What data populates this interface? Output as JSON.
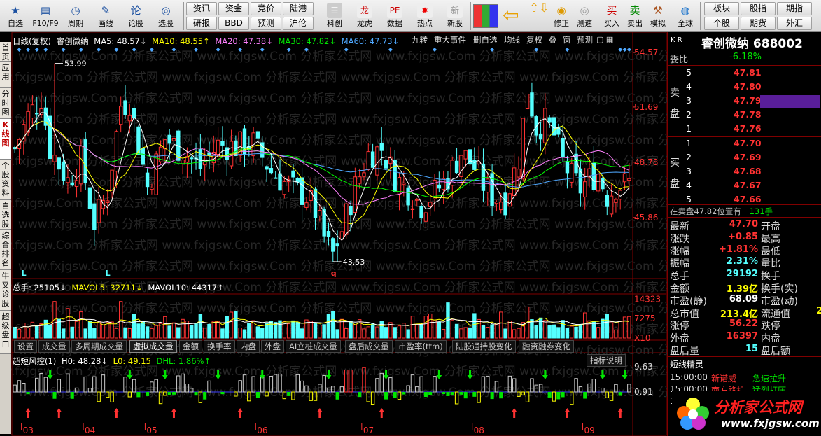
{
  "toolbar": {
    "left": [
      {
        "label": "自选",
        "icon": "star-icon"
      },
      {
        "label": "F10/F9",
        "icon": "f10-icon"
      },
      {
        "label": "周期",
        "icon": "clock-icon"
      },
      {
        "label": "画线",
        "icon": "pencil-icon"
      },
      {
        "label": "论股",
        "icon": "chat-icon"
      },
      {
        "label": "选股",
        "icon": "select-icon"
      }
    ],
    "mid_top": [
      "资讯",
      "资金",
      "竞价",
      "陆港"
    ],
    "mid_bottom": [
      "研报",
      "BBD",
      "预测",
      "沪伦"
    ],
    "icons": [
      {
        "label": "科创",
        "icon": "kechuang-icon"
      },
      {
        "label": "龙虎",
        "icon": "dragon-icon"
      },
      {
        "label": "数据",
        "icon": "data-icon"
      },
      {
        "label": "热点",
        "icon": "hot-icon"
      },
      {
        "label": "新股",
        "icon": "newstock-icon"
      }
    ],
    "right": [
      {
        "label": "修正",
        "icon": "correct-icon"
      },
      {
        "label": "测速",
        "icon": "speed-icon"
      },
      {
        "label": "买入",
        "icon": "buy-icon"
      },
      {
        "label": "卖出",
        "icon": "sell-icon"
      },
      {
        "label": "模拟",
        "icon": "hammer-icon"
      },
      {
        "label": "全球",
        "icon": "globe-icon"
      }
    ],
    "far_top": [
      "板块",
      "股指",
      "期指"
    ],
    "far_bottom": [
      "个股",
      "期货",
      "外汇"
    ]
  },
  "left_tabs": [
    "首页",
    "应用",
    "分时图",
    "K线图",
    "个股资料",
    "自选股",
    "综合排名",
    "牛叉诊股",
    "超级盘口"
  ],
  "header": {
    "period": "日线(复权)",
    "name": "睿创微纳",
    "ma5": "MA5: 48.57↓",
    "ma10": "MA10: 48.55↑",
    "ma20": "MA20: 47.38↓",
    "ma30": "MA30: 47.82↓",
    "ma60": "MA60: 47.73↓"
  },
  "top_buttons": [
    "九转",
    "重大事件",
    "删自选",
    "均线",
    "复权",
    "叠",
    "窗",
    "预测"
  ],
  "price_axis": [
    "54.57",
    "51.69",
    "48.78",
    "45.86"
  ],
  "annotations": {
    "high": "53.99",
    "low": "43.53",
    "low_mark": "q",
    "l_mark": "L"
  },
  "vol_header": {
    "total": "总手: 25105↓",
    "mavol5": "MAVOL5: 32711↓",
    "mavol10": "MAVOL10: 44317↑"
  },
  "vol_axis": [
    "14323",
    "7275",
    "X10"
  ],
  "bottom_tabs": [
    "设置",
    "成交量",
    "多周期成交量",
    "虚拟成交量",
    "金额",
    "换手率",
    "内盘",
    "外盘",
    "AI立桩成交量",
    "盘后成交量",
    "市盈率(ttm)",
    "陆股通持股变化",
    "融资融券变化"
  ],
  "ind_header": {
    "name": "超短风控(1)",
    "h0": "H0: 48.28↓",
    "l0": "L0: 49.15",
    "dhl": "DHL: 1.86%↑"
  },
  "ind_button": "指标说明",
  "ind_axis": [
    "9.63",
    "0.91"
  ],
  "months": [
    "03",
    "04",
    "05",
    "06",
    "07",
    "08",
    "09"
  ],
  "right": {
    "kr": "K R",
    "title": "睿创微纳 688002",
    "weibi_label": "委比",
    "weibi": "-6.18%",
    "sell_label": "卖盘",
    "buy_label": "买盘",
    "asks": [
      {
        "n": "5",
        "p": "47.81"
      },
      {
        "n": "4",
        "p": "47.80"
      },
      {
        "n": "3",
        "p": "47.79"
      },
      {
        "n": "2",
        "p": "47.78"
      },
      {
        "n": "1",
        "p": "47.76"
      }
    ],
    "bids": [
      {
        "n": "1",
        "p": "47.70"
      },
      {
        "n": "2",
        "p": "47.69"
      },
      {
        "n": "3",
        "p": "47.68"
      },
      {
        "n": "4",
        "p": "47.67"
      },
      {
        "n": "5",
        "p": "47.66"
      }
    ],
    "status": "在卖盘47.82位置有",
    "status_qty": "131手",
    "quote": [
      {
        "l": "最新",
        "v": "47.70",
        "l2": "开盘",
        "c": "red"
      },
      {
        "l": "涨跌",
        "v": "+0.85",
        "l2": "最高",
        "c": "red"
      },
      {
        "l": "涨幅",
        "v": "+1.81%",
        "l2": "最低",
        "c": "red"
      },
      {
        "l": "振幅",
        "v": "2.31%",
        "l2": "量比",
        "c": "cyan"
      },
      {
        "l": "总手",
        "v": "29192",
        "l2": "换手",
        "c": "cyan"
      },
      {
        "l": "金额",
        "v": "1.39亿",
        "l2": "换手(实)",
        "c": "yellow"
      },
      {
        "l": "市盈(静)",
        "v": "68.09",
        "l2": "市盈(动)",
        "c": "white"
      },
      {
        "l": "总市值",
        "v": "213.4亿",
        "l2": "流通值",
        "c": "yellow"
      },
      {
        "l": "涨停",
        "v": "56.22",
        "l2": "跌停",
        "c": "red"
      },
      {
        "l": "外盘",
        "v": "16397",
        "l2": "内盘",
        "c": "red"
      },
      {
        "l": "盘后量",
        "v": "15",
        "l2": "盘后额",
        "c": "cyan"
      }
    ],
    "liutong_extra": "2",
    "short_title": "短线精灵",
    "short": [
      {
        "t": "15:00:00",
        "n": "新诺威",
        "e": "急速拉升"
      },
      {
        "t": "15:00:00",
        "n": "南方路机",
        "e": "猛烈打压"
      },
      {
        "t": "15:00:00",
        "n": "",
        "e": ""
      }
    ]
  },
  "logo": {
    "text": "分析家公式网",
    "url": "www.fxjgsw.com"
  },
  "watermark": "www.fxjgsw.Com 分析家公式网",
  "colors": {
    "up": "#ff3232",
    "down": "#54ffff",
    "ma5": "#ffffff",
    "ma10": "#ffff00",
    "ma20": "#ff80ff",
    "ma30": "#00ff00",
    "ma60": "#4fa8ff"
  }
}
